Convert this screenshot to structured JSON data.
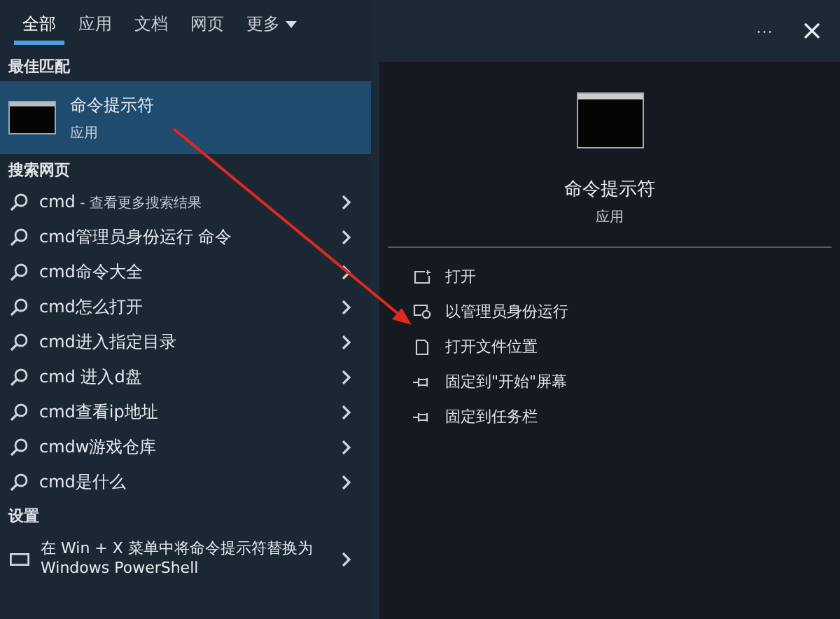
{
  "tabs": [
    {
      "label": "全部",
      "selected": true
    },
    {
      "label": "应用",
      "selected": false
    },
    {
      "label": "文档",
      "selected": false
    },
    {
      "label": "网页",
      "selected": false
    },
    {
      "label": "更多",
      "selected": false,
      "dropdown": true
    }
  ],
  "top_actions": {
    "more": "···"
  },
  "best_match": {
    "heading": "最佳匹配",
    "title": "命令提示符",
    "subtitle": "应用",
    "selected": true
  },
  "web_search": {
    "heading": "搜索网页",
    "items": [
      {
        "text": "cmd",
        "note": " - 查看更多搜索结果"
      },
      {
        "text": "cmd管理员身份运行 命令"
      },
      {
        "text": "cmd命令大全"
      },
      {
        "text": "cmd怎么打开"
      },
      {
        "text": "cmd进入指定目录"
      },
      {
        "text": "cmd 进入d盘"
      },
      {
        "text": "cmd查看ip地址"
      },
      {
        "text": "cmdw游戏仓库"
      },
      {
        "text": "cmd是什么"
      }
    ]
  },
  "settings": {
    "heading": "设置",
    "items": [
      {
        "text": "在 Win + X 菜单中将命令提示符替换为 Windows PowerShell"
      }
    ]
  },
  "detail": {
    "title": "命令提示符",
    "subtitle": "应用",
    "actions": [
      {
        "kind": "open",
        "label": "打开"
      },
      {
        "kind": "admin",
        "label": "以管理员身份运行"
      },
      {
        "kind": "folder",
        "label": "打开文件位置"
      },
      {
        "kind": "pin",
        "label": "固定到\"开始\"屏幕"
      },
      {
        "kind": "pin",
        "label": "固定到任务栏"
      }
    ]
  }
}
